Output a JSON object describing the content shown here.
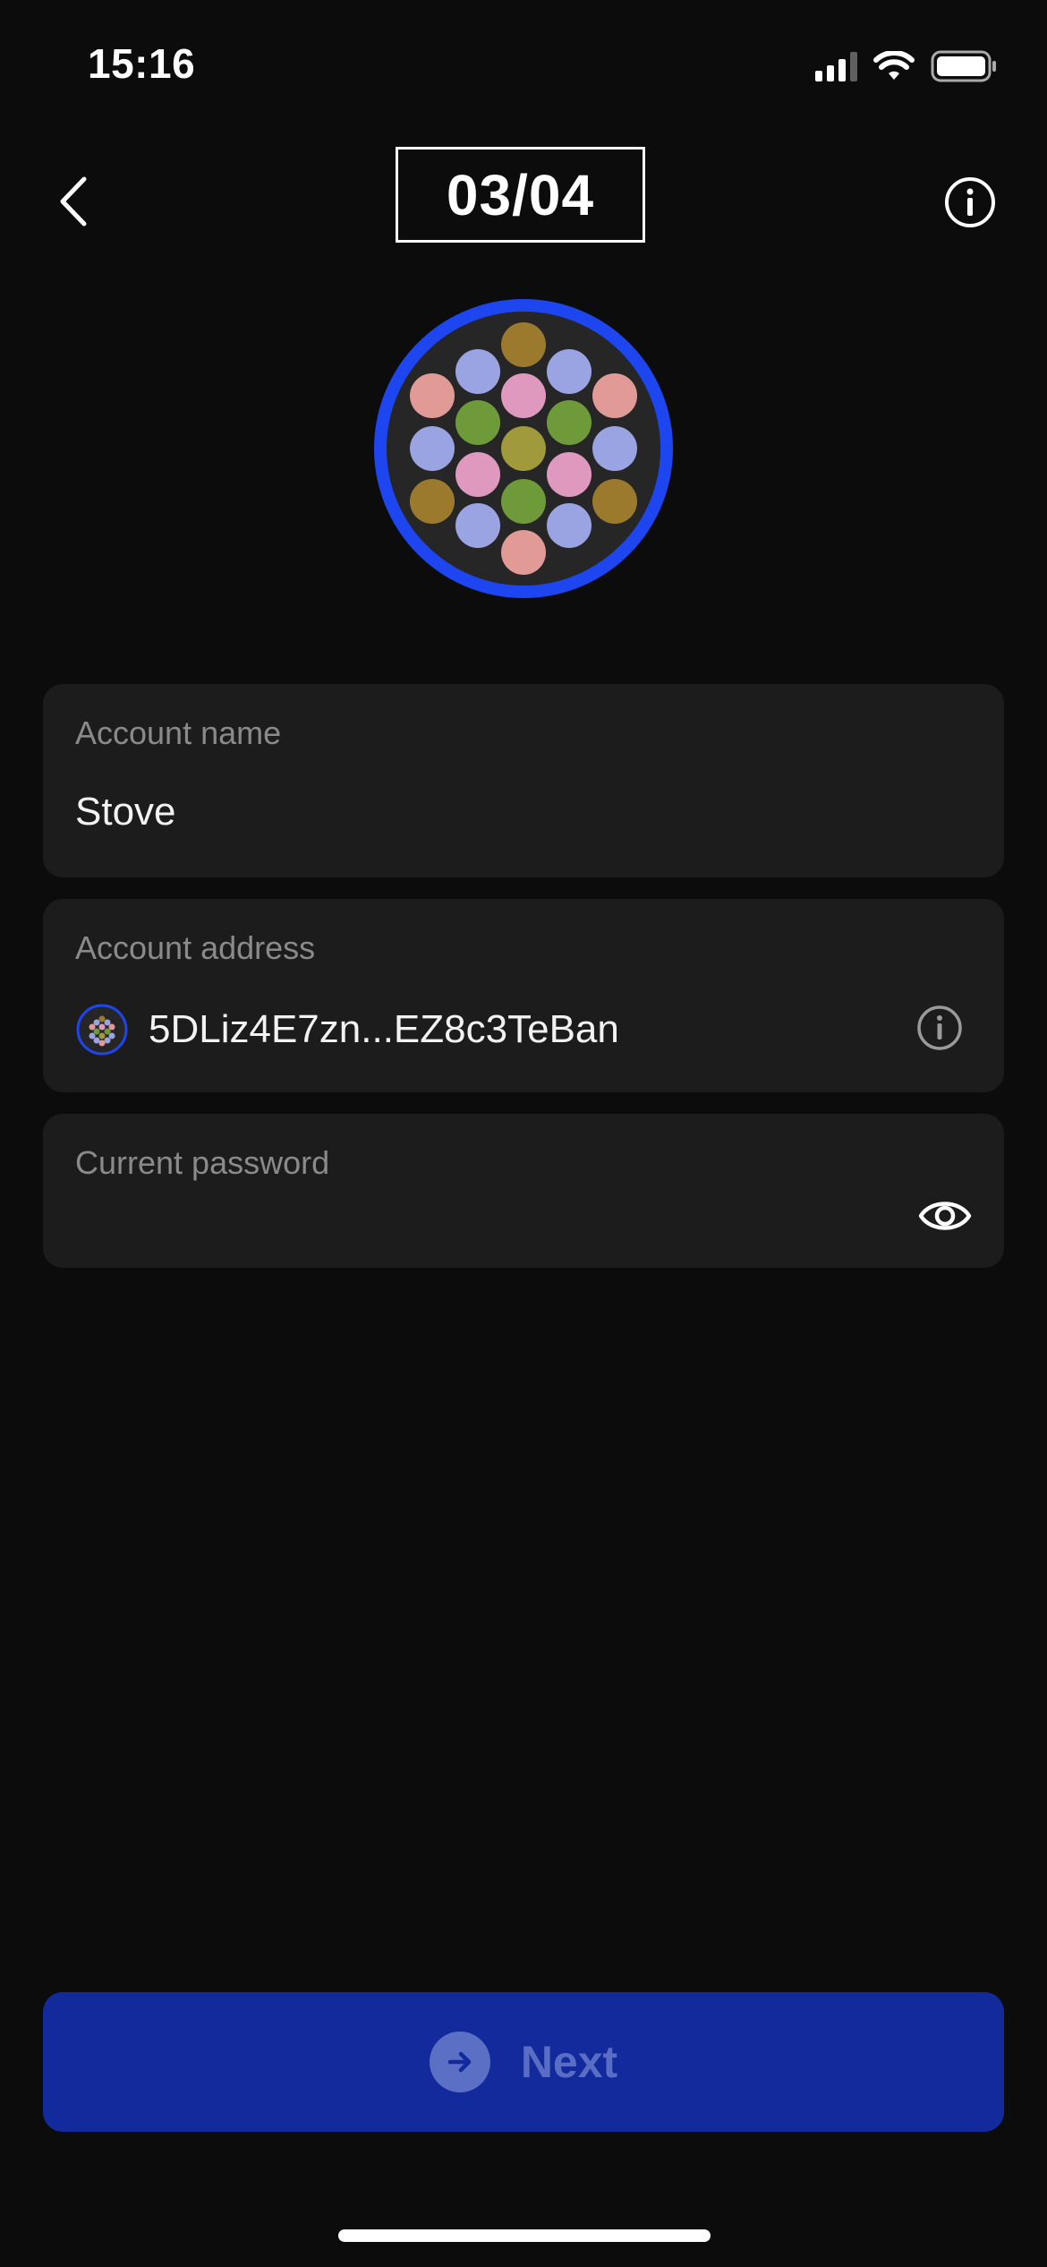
{
  "status_bar": {
    "time": "15:16"
  },
  "header": {
    "step": "03/04"
  },
  "account_name": {
    "label": "Account name",
    "value": "Stove"
  },
  "account_address": {
    "label": "Account address",
    "value": "5DLiz4E7zn...EZ8c3TeBan"
  },
  "current_password": {
    "label": "Current password",
    "value": ""
  },
  "next_button": {
    "label": "Next"
  },
  "colors": {
    "background": "#0c0c0c",
    "field_bg": "#1c1c1c",
    "accent_blue": "#1e46f0",
    "button_bg": "#122a9c"
  },
  "icons": [
    "back-chevron-icon",
    "info-icon",
    "eye-icon",
    "arrow-right-icon",
    "identicon"
  ]
}
